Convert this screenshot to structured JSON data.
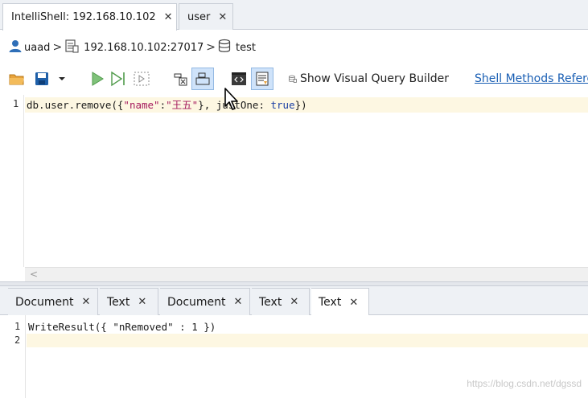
{
  "tabs": [
    {
      "label": "IntelliShell: 192.168.10.102",
      "close": "✕"
    },
    {
      "label": "user",
      "close": "✕"
    }
  ],
  "breadcrumb": {
    "user": "uaad",
    "server": "192.168.10.102:27017",
    "database": "test",
    "sep": ">"
  },
  "toolbar": {
    "visual_query_label": "Show Visual Query Builder",
    "shell_methods_label": "Shell Methods Refere"
  },
  "editor": {
    "lines": [
      {
        "num": "1",
        "tokens": [
          {
            "text": "db.user.remove({",
            "cls": ""
          },
          {
            "text": "\"name\"",
            "cls": "c-str"
          },
          {
            "text": ":",
            "cls": ""
          },
          {
            "text": "\"王五\"",
            "cls": "c-str"
          },
          {
            "text": "}, ",
            "cls": ""
          },
          {
            "text": "justOne",
            "cls": ""
          },
          {
            "text": ": ",
            "cls": ""
          },
          {
            "text": "true",
            "cls": "c-kw"
          },
          {
            "text": "})",
            "cls": ""
          }
        ]
      }
    ],
    "scroll_arrow": "<"
  },
  "result_tabs": [
    {
      "label": "Document",
      "close": "✕",
      "active": false
    },
    {
      "label": "Text",
      "close": "✕",
      "active": false
    },
    {
      "label": "Document",
      "close": "✕",
      "active": false
    },
    {
      "label": "Text",
      "close": "✕",
      "active": false
    },
    {
      "label": "Text",
      "close": "✕",
      "active": true
    }
  ],
  "result": {
    "lines": [
      {
        "num": "1",
        "text": "WriteResult({ \"nRemoved\" : 1 })"
      },
      {
        "num": "2",
        "text": ""
      }
    ]
  },
  "watermark": "https://blog.csdn.net/dgssd",
  "colors": {
    "accent": "#1a5fb4",
    "string": "#a4185c",
    "keyword": "#1a3fa4",
    "highlight": "#fdf7e2"
  }
}
